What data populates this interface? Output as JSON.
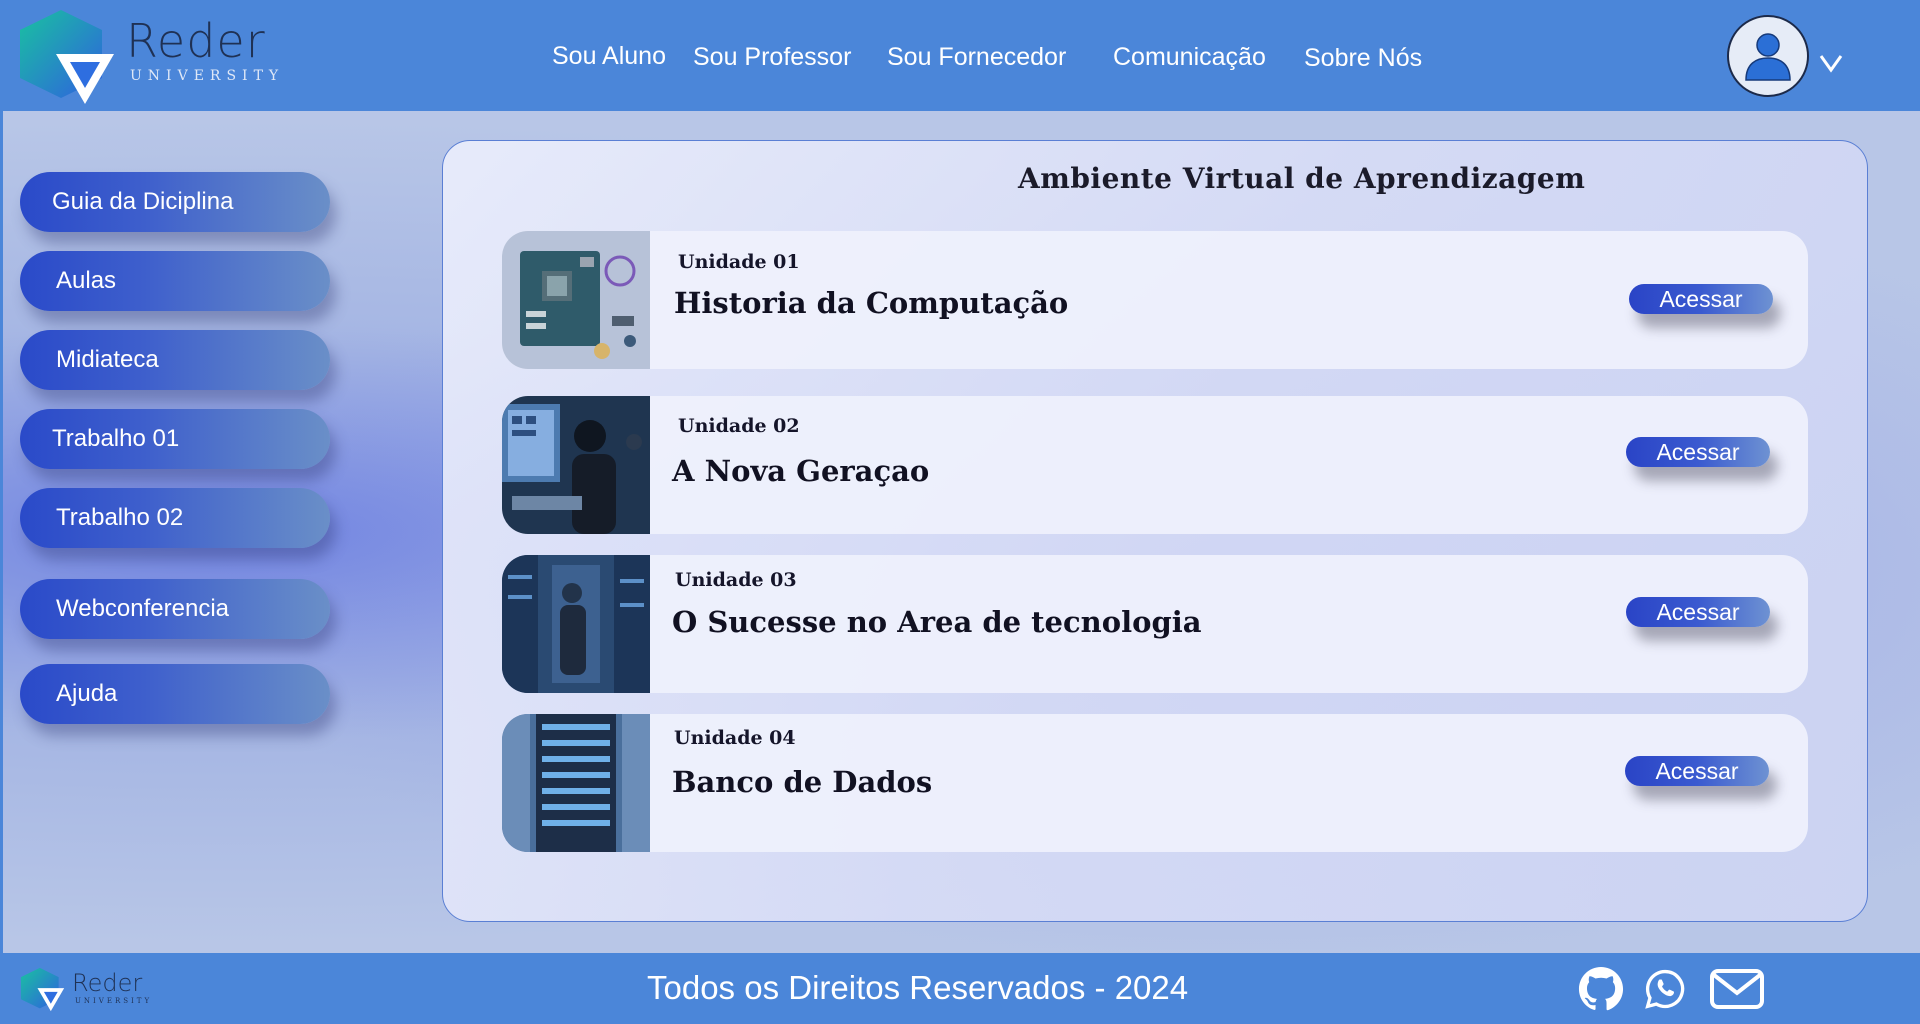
{
  "header": {
    "logo": {
      "name": "Reder",
      "subtitle": "UNIVERSITY"
    },
    "nav": [
      {
        "label": "Sou Aluno"
      },
      {
        "label": "Sou Professor"
      },
      {
        "label": "Sou Fornecedor"
      },
      {
        "label": "Comunicação"
      },
      {
        "label": "Sobre Nós"
      }
    ],
    "user_icon": "user-avatar-icon",
    "menu_icon": "chevron-down-icon"
  },
  "sidebar": {
    "items": [
      {
        "label": "Guia da Diciplina"
      },
      {
        "label": "Aulas"
      },
      {
        "label": "Midiateca"
      },
      {
        "label": "Trabalho 01"
      },
      {
        "label": "Trabalho 02"
      },
      {
        "label": "Webconferencia"
      },
      {
        "label": "Ajuda"
      }
    ]
  },
  "main": {
    "title": "Ambiente Virtual de Aprendizagem",
    "units": [
      {
        "unit": "Unidade 01",
        "title": "Historia da Computação",
        "button": "Acessar",
        "image": "circuit-board-image"
      },
      {
        "unit": "Unidade 02",
        "title": "A Nova Geraçao",
        "button": "Acessar",
        "image": "programmer-at-computer-image"
      },
      {
        "unit": "Unidade 03",
        "title": "O Sucesse no Area de tecnologia",
        "button": "Acessar",
        "image": "woman-in-datacenter-image"
      },
      {
        "unit": "Unidade 04",
        "title": "Banco de Dados",
        "button": "Acessar",
        "image": "server-rack-image"
      }
    ]
  },
  "footer": {
    "logo": {
      "name": "Reder",
      "subtitle": "UNIVERSITY"
    },
    "copyright": "Todos os Direitos Reservados - 2024",
    "icons": [
      "github-icon",
      "whatsapp-icon",
      "mail-icon"
    ]
  },
  "colors": {
    "header_bg": "#4b86d9",
    "button_blue": "#2a44c6",
    "logo_teal": "#1fb3a8",
    "logo_blue": "#2d64d8"
  }
}
